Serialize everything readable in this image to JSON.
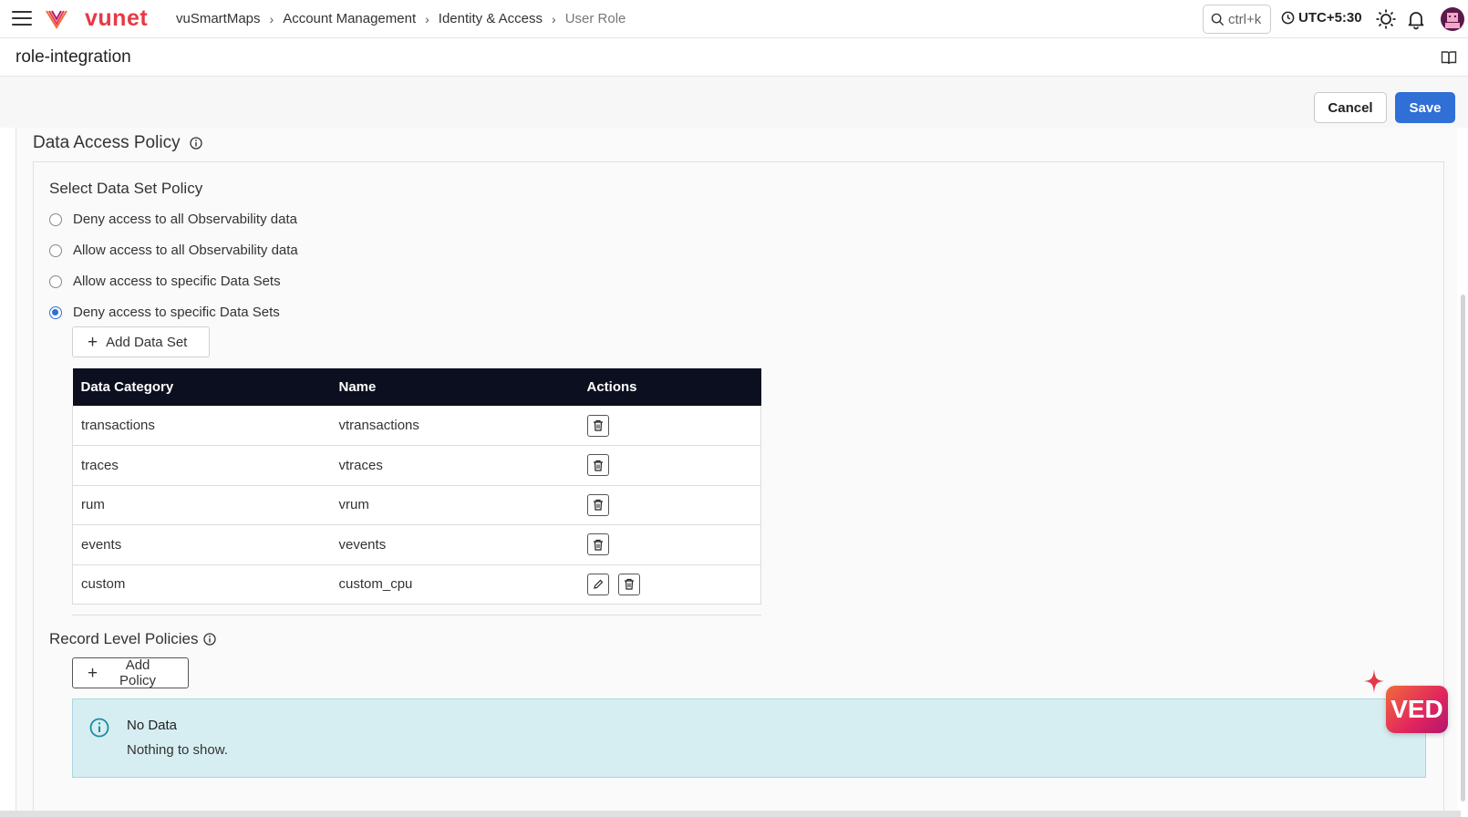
{
  "header": {
    "logo_text": "vunet",
    "breadcrumbs": [
      "vuSmartMaps",
      "Account Management",
      "Identity & Access",
      "User Role"
    ],
    "breadcrumb_separator": "›",
    "search_shortcut": "ctrl+k",
    "timezone": "UTC+5:30",
    "icons": [
      "menu-icon",
      "search-icon",
      "clock-icon",
      "sun-icon",
      "bell-icon",
      "avatar"
    ]
  },
  "page": {
    "title": "role-integration"
  },
  "actions": {
    "cancel_label": "Cancel",
    "save_label": "Save",
    "primary_color": "#2f6fd6"
  },
  "data_access": {
    "section_title": "Data Access Policy",
    "card_title": "Select Data Set Policy",
    "options": [
      {
        "label": "Deny access to all Observability data",
        "selected": false
      },
      {
        "label": "Allow access to all Observability data",
        "selected": false
      },
      {
        "label": "Allow access to specific Data Sets",
        "selected": false
      },
      {
        "label": "Deny access to specific Data Sets",
        "selected": true
      }
    ],
    "add_data_set_label": "Add Data Set",
    "table": {
      "columns": [
        "Data Category",
        "Name",
        "Actions"
      ],
      "rows": [
        {
          "category": "transactions",
          "name": "vtransactions",
          "actions": [
            "delete"
          ]
        },
        {
          "category": "traces",
          "name": "vtraces",
          "actions": [
            "delete"
          ]
        },
        {
          "category": "rum",
          "name": "vrum",
          "actions": [
            "delete"
          ]
        },
        {
          "category": "events",
          "name": "vevents",
          "actions": [
            "delete"
          ]
        },
        {
          "category": "custom",
          "name": "custom_cpu",
          "actions": [
            "edit",
            "delete"
          ]
        }
      ],
      "header_color": "#0b0f1f"
    },
    "record_policies_title": "Record Level Policies",
    "add_policy_label": "Add Policy",
    "empty_state": {
      "title": "No Data",
      "message": "Nothing to show."
    }
  },
  "assistant": {
    "label": "VED"
  }
}
